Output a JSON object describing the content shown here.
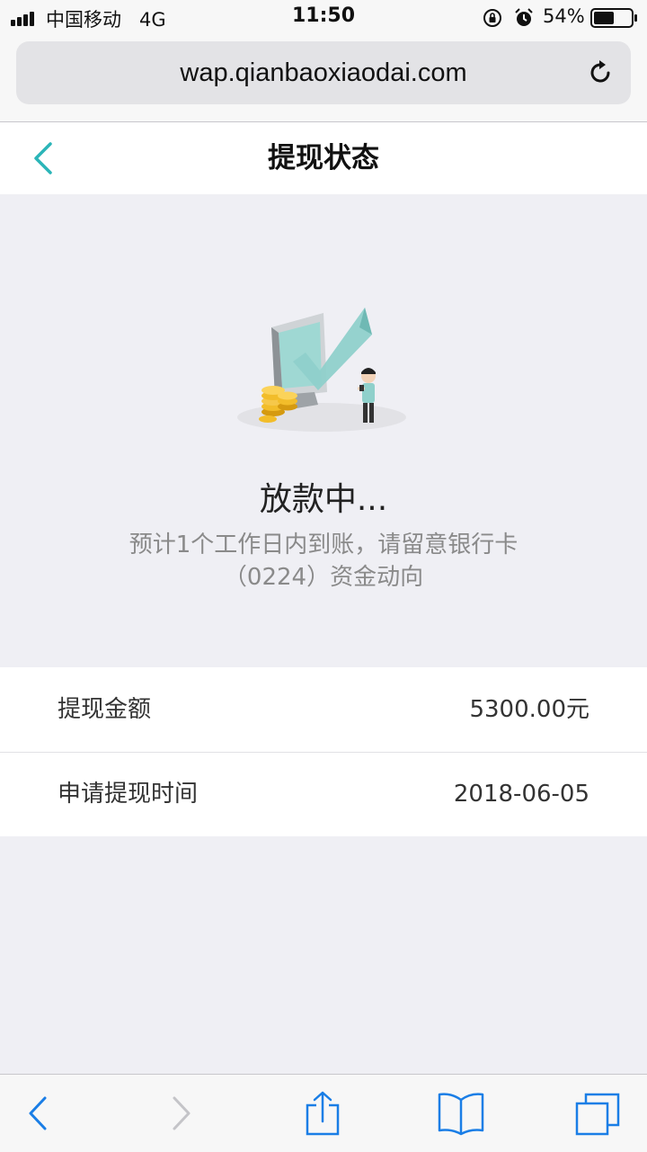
{
  "status_bar": {
    "carrier": "中国移动",
    "network": "4G",
    "time": "11:50",
    "battery_percent": "54%",
    "battery_level": 0.54,
    "icons": [
      "signal-icon",
      "orientation-lock-icon",
      "alarm-icon",
      "battery-icon"
    ]
  },
  "browser": {
    "url": "wap.qianbaoxiaodai.com",
    "reload_icon": "reload-icon"
  },
  "nav": {
    "title": "提现状态",
    "back_icon": "back-chevron-icon"
  },
  "status": {
    "title": "放款中...",
    "description": "预计1个工作日内到账，请留意银行卡（0224）资金动向",
    "illustration": "withdrawal-illustration"
  },
  "details": [
    {
      "label": "提现金额",
      "value": "5300.00元"
    },
    {
      "label": "申请提现时间",
      "value": "2018-06-05"
    }
  ],
  "toolbar": {
    "icons": [
      "back-icon",
      "forward-icon",
      "share-icon",
      "bookmarks-icon",
      "tabs-icon"
    ]
  },
  "colors": {
    "accent": "#2bb5b8",
    "ios_blue": "#1a7ee6",
    "background": "#efeff4"
  }
}
